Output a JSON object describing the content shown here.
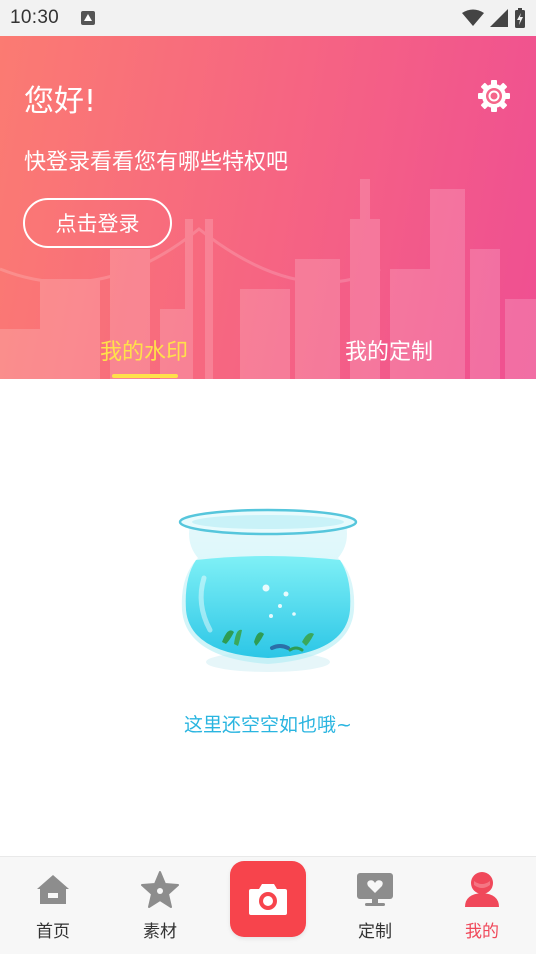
{
  "status_bar": {
    "time": "10:30"
  },
  "header": {
    "greeting": "您好!",
    "subtitle": "快登录看看您有哪些特权吧",
    "login_button": "点击登录",
    "tabs": [
      {
        "label": "我的水印",
        "active": true
      },
      {
        "label": "我的定制",
        "active": false
      }
    ],
    "gradient_colors": [
      "#fb7b72",
      "#ef4f92"
    ],
    "active_tab_color": "#ffe14a"
  },
  "empty_state": {
    "message": "这里还空空如也哦~",
    "icon": "fishbowl-illustration",
    "text_color": "#2ab5e0"
  },
  "bottom_nav": {
    "items": [
      {
        "label": "首页",
        "icon": "home-icon",
        "active": false
      },
      {
        "label": "素材",
        "icon": "star-icon",
        "active": false
      },
      {
        "label": "",
        "icon": "camera-icon",
        "active": false
      },
      {
        "label": "定制",
        "icon": "monitor-heart-icon",
        "active": false
      },
      {
        "label": "我的",
        "icon": "user-icon",
        "active": true
      }
    ],
    "active_color": "#f0485a",
    "camera_color": "#f7444c"
  }
}
